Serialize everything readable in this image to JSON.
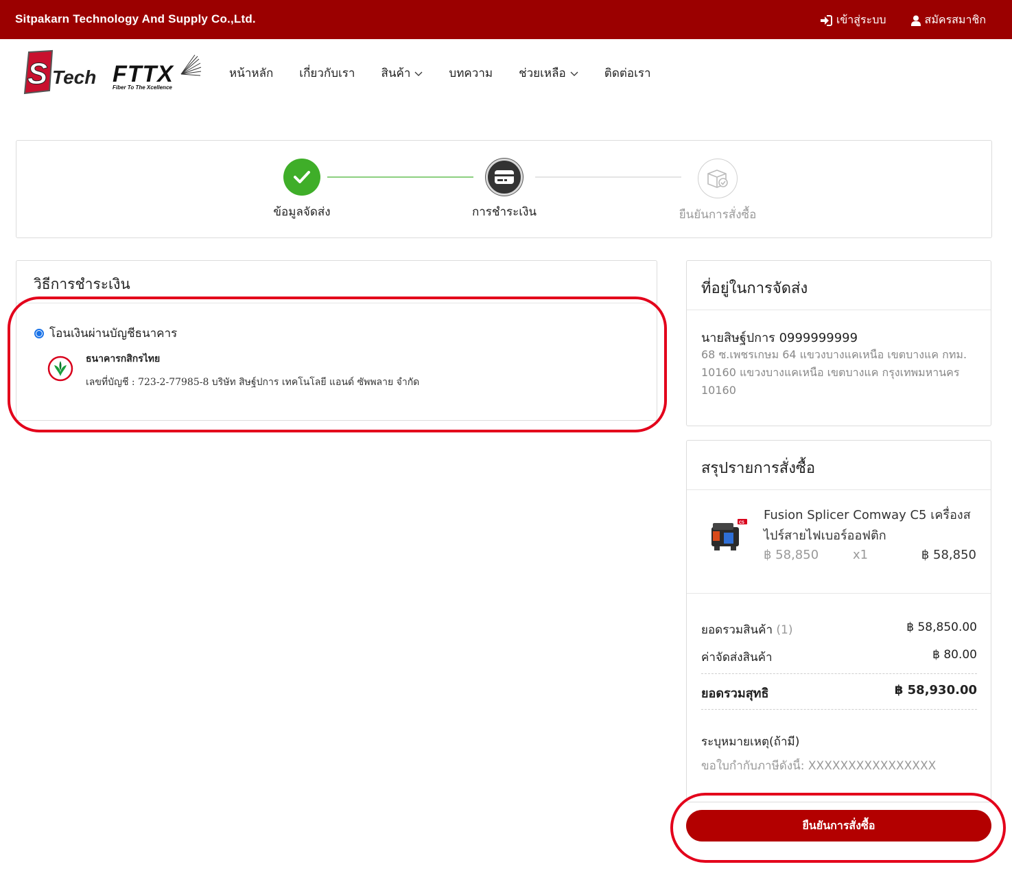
{
  "topbar": {
    "company": "Sitpakarn Technology And Supply Co.,Ltd.",
    "login": "เข้าสู่ระบบ",
    "register": "สมัครสมาชิก"
  },
  "logo": {
    "brand": "Tech",
    "fttx": "FTTX",
    "tagline": "Fiber To The Xcellence"
  },
  "nav": {
    "home": "หน้าหลัก",
    "about": "เกี่ยวกับเรา",
    "products": "สินค้า",
    "articles": "บทความ",
    "help": "ช่วยเหลือ",
    "contact": "ติดต่อเรา"
  },
  "stepper": {
    "step1": "ข้อมูลจัดส่ง",
    "step2": "การชำระเงิน",
    "step3": "ยืนยันการสั่งซื้อ"
  },
  "payment": {
    "title": "วิธีการชำระเงิน",
    "option": "โอนเงินผ่านบัญชีธนาคาร",
    "bank_name": "ธนาคารกสิกรไทย",
    "account": "เลขที่บัญชี : 723-2-77985-8 บริษัท สิษฐ์ปการ เทคโนโลยี แอนด์ ซัพพลาย จำกัด"
  },
  "address": {
    "title": "ที่อยู่ในการจัดส่ง",
    "name_phone": "นายสิษฐ์ปการ 0999999999",
    "detail": "68 ซ.เพชรเกษม 64 แขวงบางแคเหนือ เขตบางแค กทม. 10160 แขวงบางแคเหนือ เขตบางแค กรุงเทพมหานคร 10160"
  },
  "summary": {
    "title": "สรุปรายการสั่งซื้อ",
    "product_name": "Fusion Splicer Comway C5 เครื่องสไปร์สายไฟเบอร์ออฟติก",
    "unit_price": "฿ 58,850",
    "qty": "x1",
    "line_total": "฿ 58,850",
    "subtotal_label": "ยอดรวมสินค้า",
    "subtotal_count": "(1)",
    "subtotal_value": "฿ 58,850.00",
    "shipping_label": "ค่าจัดส่งสินค้า",
    "shipping_value": "฿ 80.00",
    "net_label": "ยอดรวมสุทธิ",
    "net_value": "฿ 58,930.00",
    "note_label": "ระบุหมายเหตุ(ถ้ามี)",
    "note_value": "ขอใบกำกับภาษีดังนี้: XXXXXXXXXXXXXXXX"
  },
  "confirm_button": "ยืนยันการสั่งซื้อ",
  "colors": {
    "brand": "#9b0000",
    "button": "#b30000",
    "highlight": "#e3001b",
    "step_done": "#3fae29",
    "step_active": "#333333",
    "radio": "#1a73e8"
  }
}
